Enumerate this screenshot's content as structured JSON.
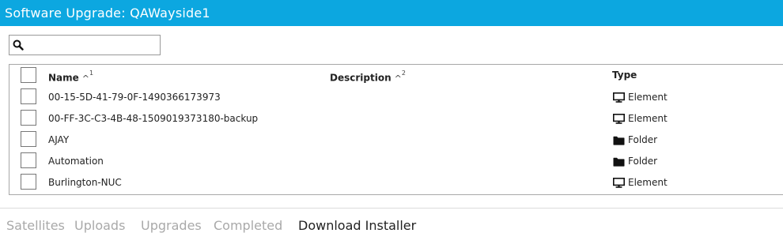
{
  "header": {
    "title": "Software Upgrade: QAWayside1"
  },
  "search": {
    "value": "",
    "placeholder": ""
  },
  "table": {
    "columns": [
      {
        "label": "Name",
        "sort_order": "1"
      },
      {
        "label": "Description",
        "sort_order": "2"
      },
      {
        "label": "Type"
      }
    ],
    "rows": [
      {
        "name": "00-15-5D-41-79-0F-1490366173973",
        "description": "",
        "type": "Element",
        "type_icon": "monitor-icon"
      },
      {
        "name": "00-FF-3C-C3-4B-48-1509019373180-backup",
        "description": "",
        "type": "Element",
        "type_icon": "monitor-icon"
      },
      {
        "name": "AJAY",
        "description": "",
        "type": "Folder",
        "type_icon": "folder-icon"
      },
      {
        "name": "Automation",
        "description": "",
        "type": "Folder",
        "type_icon": "folder-icon"
      },
      {
        "name": "Burlington-NUC",
        "description": "",
        "type": "Element",
        "type_icon": "monitor-icon"
      }
    ]
  },
  "tabs": [
    {
      "label": "Satellites",
      "active": false
    },
    {
      "label": "Uploads",
      "active": false
    },
    {
      "label": "Upgrades",
      "active": false
    },
    {
      "label": "Completed",
      "active": false
    },
    {
      "label": "Download Installer",
      "active": true
    }
  ],
  "colors": {
    "title_bar": "#0ca7e0",
    "tab_inactive": "#a9a9a9",
    "tab_active": "#222222"
  }
}
